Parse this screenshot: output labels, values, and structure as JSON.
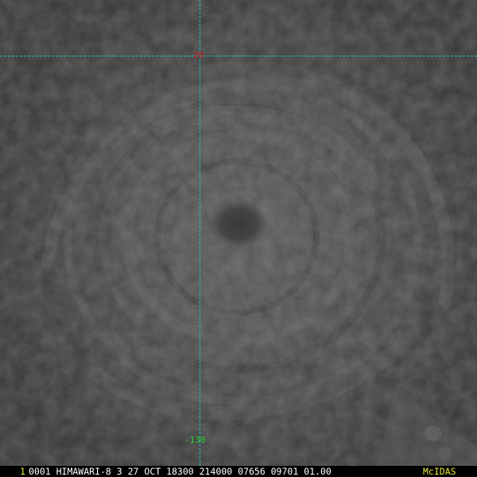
{
  "overlay": {
    "latitude_label": "20",
    "longitude_label": "-130",
    "grid_color": "#19c6c6",
    "latitude_label_color": "#d01a1a",
    "longitude_label_color": "#2fd02f"
  },
  "status_bar": {
    "frame_number": "1",
    "text": "0001 HIMAWARI-8   3 27 OCT 18300 214000 07656 09701 01.00",
    "brand": "McIDAS",
    "frame_number_color": "#e8e83a",
    "text_color": "#ffffff",
    "brand_color": "#e8e83a"
  }
}
